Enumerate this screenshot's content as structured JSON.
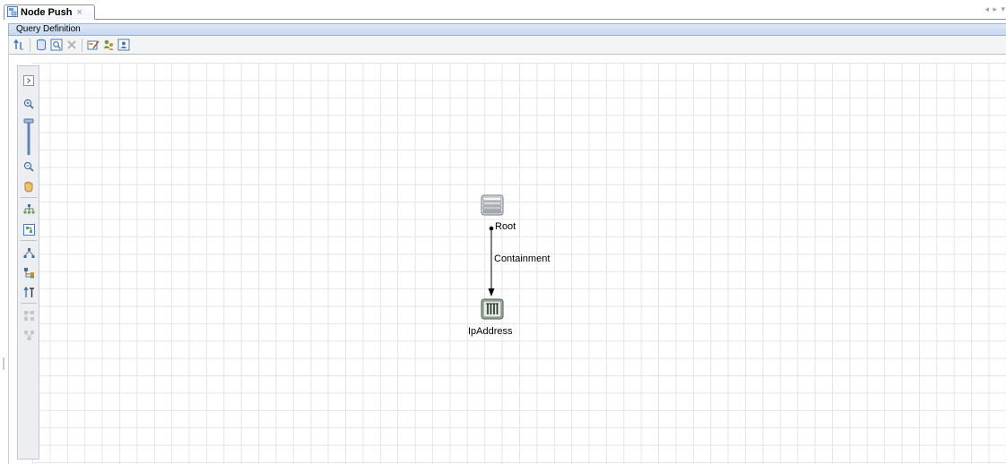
{
  "tab": {
    "title": "Node Push",
    "icon": "query-node-tab-icon",
    "close": "×"
  },
  "tab_nav": "◂ ▸ ▾",
  "panel": {
    "title": "Query Definition"
  },
  "toolbar": {
    "buttons": [
      {
        "name": "properties-arrow-icon"
      },
      {
        "name": "database-icon"
      },
      {
        "name": "preview-search-icon"
      },
      {
        "name": "delete-x-icon"
      },
      {
        "name": "edit-properties-icon"
      },
      {
        "name": "users-icon"
      },
      {
        "name": "user-calendar-icon"
      }
    ]
  },
  "palette": {
    "buttons": [
      "expand-icon",
      "zoom-in-icon",
      "zoom-slider",
      "zoom-out-icon",
      "pan-hand-icon",
      "hierarchical-layout-icon",
      "fit-to-window-icon",
      "tree-layout-icon",
      "orthogonal-layout-icon",
      "sort-icon",
      "layout-disabled-1-icon",
      "layout-disabled-2-icon"
    ]
  },
  "diagram": {
    "nodes": [
      {
        "label": "Root",
        "icon": "root-server-icon"
      },
      {
        "label": "IpAddress",
        "icon": "ip-address-icon"
      }
    ],
    "edges": [
      {
        "label": "Containment",
        "from": "Root",
        "to": "IpAddress"
      }
    ]
  }
}
